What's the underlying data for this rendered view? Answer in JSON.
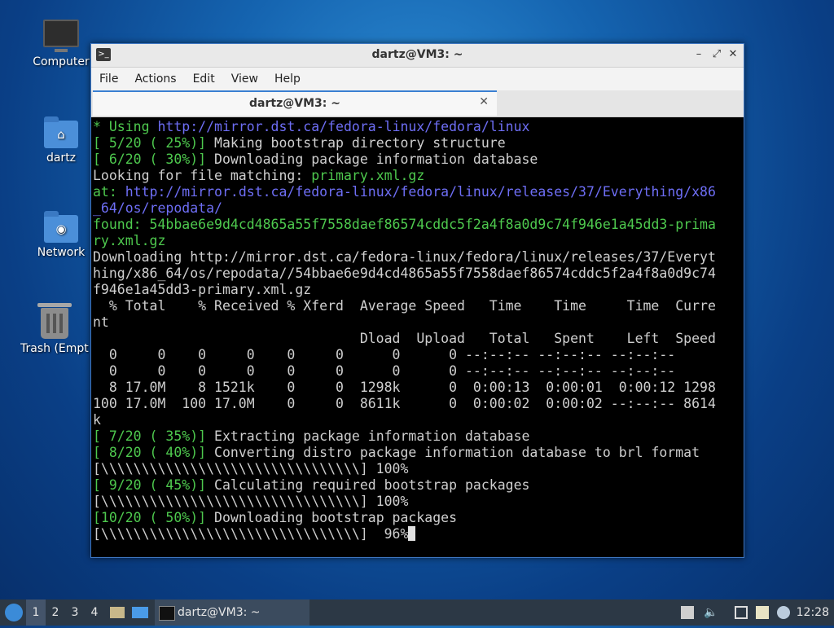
{
  "desktop": {
    "icons": [
      {
        "label": "Computer",
        "icon": "computer-icon"
      },
      {
        "label": "dartz",
        "icon": "home-folder-icon"
      },
      {
        "label": "Network",
        "icon": "network-folder-icon"
      },
      {
        "label": "Trash (Empty)",
        "icon": "trash-icon"
      }
    ]
  },
  "window": {
    "title": "dartz@VM3: ~",
    "menu": [
      "File",
      "Actions",
      "Edit",
      "View",
      "Help"
    ],
    "tab": {
      "label": "dartz@VM3: ~"
    }
  },
  "terminal": {
    "lines": [
      [
        {
          "t": "* Using ",
          "c": "g"
        },
        {
          "t": "http://mirror.dst.ca/fedora-linux/fedora/linux",
          "c": "b"
        }
      ],
      [
        {
          "t": "[ 5/20 ( 25%)] ",
          "c": "g"
        },
        {
          "t": "Making bootstrap directory structure",
          "c": ""
        }
      ],
      [
        {
          "t": "[ 6/20 ( 30%)] ",
          "c": "g"
        },
        {
          "t": "Downloading package information database",
          "c": ""
        }
      ],
      [
        {
          "t": "Looking for file matching: ",
          "c": ""
        },
        {
          "t": "primary.xml.gz",
          "c": "g"
        }
      ],
      [
        {
          "t": "at: ",
          "c": "g"
        },
        {
          "t": "http://mirror.dst.ca/fedora-linux/fedora/linux/releases/37/Everything/x86",
          "c": "b"
        }
      ],
      [
        {
          "t": "_64/os/repodata/",
          "c": "b"
        }
      ],
      [
        {
          "t": "found: ",
          "c": "g"
        },
        {
          "t": "54bbae6e9d4cd4865a55f7558daef86574cddc5f2a4f8a0d9c74f946e1a45dd3-prima",
          "c": "g"
        }
      ],
      [
        {
          "t": "ry.xml.gz",
          "c": "g"
        }
      ],
      [
        {
          "t": "Downloading http://mirror.dst.ca/fedora-linux/fedora/linux/releases/37/Everyt",
          "c": ""
        }
      ],
      [
        {
          "t": "hing/x86_64/os/repodata//54bbae6e9d4cd4865a55f7558daef86574cddc5f2a4f8a0d9c74",
          "c": ""
        }
      ],
      [
        {
          "t": "f946e1a45dd3-primary.xml.gz",
          "c": ""
        }
      ],
      [
        {
          "t": "  % Total    % Received % Xferd  Average Speed   Time    Time     Time  Curre",
          "c": ""
        }
      ],
      [
        {
          "t": "nt",
          "c": ""
        }
      ],
      [
        {
          "t": "                                 Dload  Upload   Total   Spent    Left  Speed",
          "c": ""
        }
      ],
      [
        {
          "t": "  0     0    0     0    0     0      0      0 --:--:-- --:--:-- --:--:--",
          "c": ""
        }
      ],
      [
        {
          "t": "  0     0    0     0    0     0      0      0 --:--:-- --:--:-- --:--:--",
          "c": ""
        }
      ],
      [
        {
          "t": "  8 17.0M    8 1521k    0     0  1298k      0  0:00:13  0:00:01  0:00:12 1298",
          "c": ""
        }
      ],
      [
        {
          "t": "100 17.0M  100 17.0M    0     0  8611k      0  0:00:02  0:00:02 --:--:-- 8614",
          "c": ""
        }
      ],
      [
        {
          "t": "k",
          "c": ""
        }
      ],
      [
        {
          "t": "[ 7/20 ( 35%)] ",
          "c": "g"
        },
        {
          "t": "Extracting package information database",
          "c": ""
        }
      ],
      [
        {
          "t": "[ 8/20 ( 40%)] ",
          "c": "g"
        },
        {
          "t": "Converting distro package information database to brl format",
          "c": ""
        }
      ],
      [
        {
          "t": "[\\\\\\\\\\\\\\\\\\\\\\\\\\\\\\\\\\\\\\\\\\\\\\\\\\\\\\\\\\\\\\\\] 100%",
          "c": ""
        }
      ],
      [
        {
          "t": "[ 9/20 ( 45%)] ",
          "c": "g"
        },
        {
          "t": "Calculating required bootstrap packages",
          "c": ""
        }
      ],
      [
        {
          "t": "[\\\\\\\\\\\\\\\\\\\\\\\\\\\\\\\\\\\\\\\\\\\\\\\\\\\\\\\\\\\\\\\\] 100%",
          "c": ""
        }
      ],
      [
        {
          "t": "[10/20 ( 50%)] ",
          "c": "g"
        },
        {
          "t": "Downloading bootstrap packages",
          "c": ""
        }
      ],
      [
        {
          "t": "[\\\\\\\\\\\\\\\\\\\\\\\\\\\\\\\\\\\\\\\\\\\\\\\\\\\\\\\\\\\\\\\\]  96%",
          "c": ""
        }
      ]
    ]
  },
  "taskbar": {
    "workspaces": [
      "1",
      "2",
      "3",
      "4"
    ],
    "active_workspace": "1",
    "task": {
      "label": "dartz@VM3: ~"
    },
    "clock": "12:28"
  },
  "colors": {
    "accent": "#3a7fd2",
    "term_green": "#4ec94e",
    "term_blue": "#6e6ef5"
  }
}
